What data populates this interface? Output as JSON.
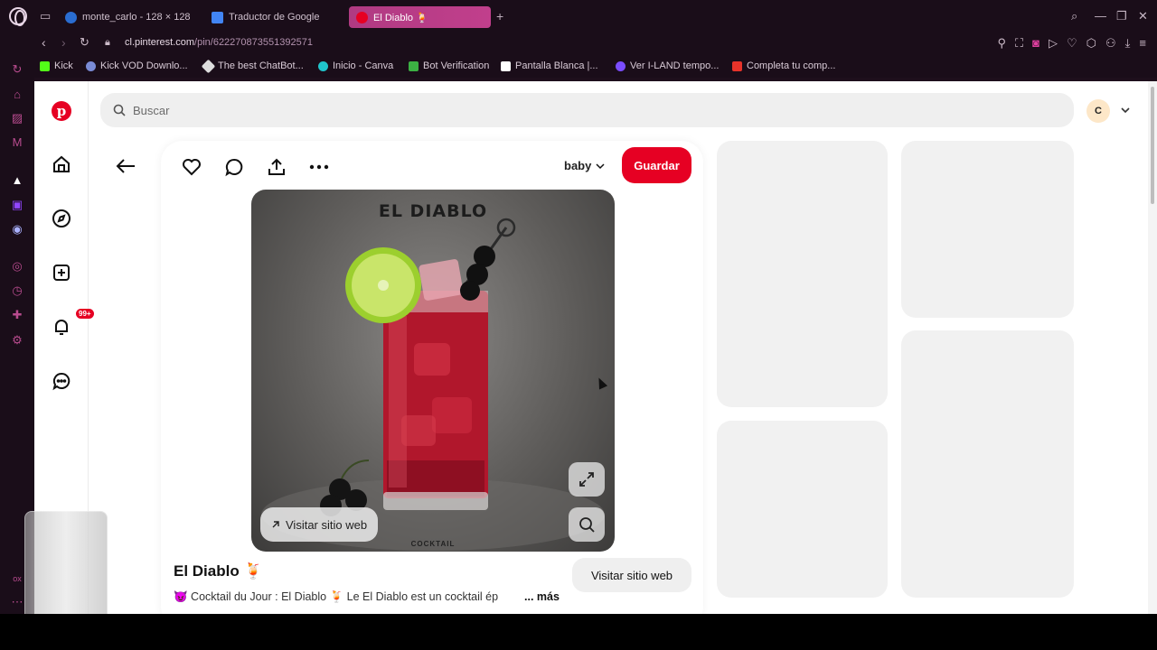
{
  "browser": {
    "tabs": [
      {
        "label": "monte_carlo - 128 × 128 p",
        "favicon_color": "#2a6dd1"
      },
      {
        "label": "Traductor de Google",
        "favicon_color": "#4285f4"
      },
      {
        "label": "El Diablo 🍹",
        "favicon_color": "#e60023",
        "active": true
      }
    ],
    "new_tab": "+",
    "url_domain": "cl.pinterest.com",
    "url_path": "/pin/622270873551392571",
    "bookmarks": [
      {
        "label": "Kick",
        "color": "#53fc18"
      },
      {
        "label": "Kick VOD Downlo...",
        "color": "#7a8bd6"
      },
      {
        "label": "The best ChatBot...",
        "color": "#dddddd"
      },
      {
        "label": "Inicio - Canva",
        "color": "#20c4cb"
      },
      {
        "label": "Bot Verification",
        "color": "#3cb043"
      },
      {
        "label": "Pantalla Blanca |...",
        "color": "#ffffff"
      },
      {
        "label": "Ver I-LAND tempo...",
        "color": "#7b4dff"
      },
      {
        "label": "Completa tu comp...",
        "color": "#e8332a"
      }
    ]
  },
  "pinterest": {
    "search_placeholder": "Buscar",
    "avatar_initial": "C",
    "notification_badge": "99+",
    "board_name": "baby",
    "save_label": "Guardar",
    "pin": {
      "image_title": "EL DIABLO",
      "image_subtitle": "COCKTAIL",
      "overlay_visit": "Visitar sitio web",
      "title": "El Diablo 🍹",
      "description": "😈 Cocktail du Jour : El Diablo 🍹 Le El Diablo est un cocktail ép",
      "more": "... más",
      "visit_button": "Visitar sitio web"
    },
    "brand_color": "#e60023"
  }
}
